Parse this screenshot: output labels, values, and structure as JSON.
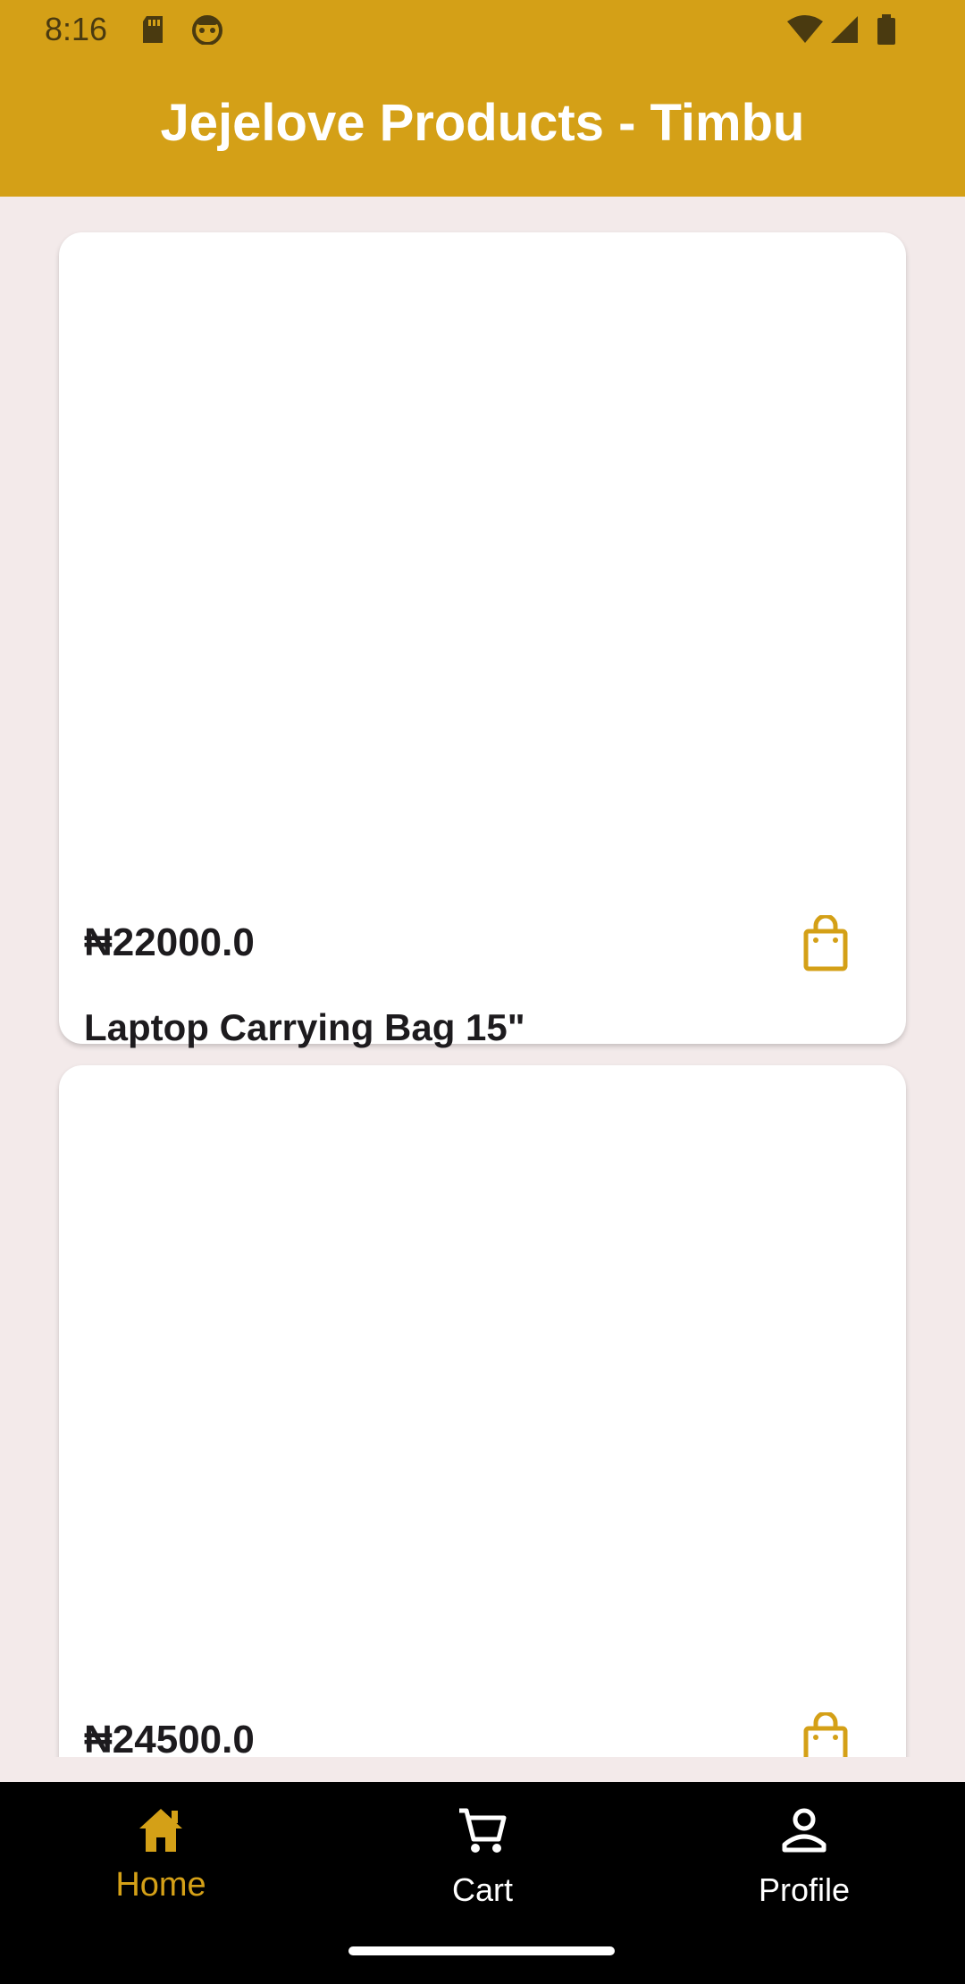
{
  "status_bar": {
    "time": "8:16",
    "icons": [
      "sd-card-icon",
      "android-face-icon",
      "wifi-icon",
      "signal-icon",
      "battery-icon"
    ]
  },
  "app_bar": {
    "title": "Jejelove Products - Timbu",
    "color": "#d4a017"
  },
  "products": [
    {
      "price": "₦22000.0",
      "name": "Laptop Carrying Bag 15\""
    },
    {
      "price": "₦24500.0",
      "name": ""
    }
  ],
  "bottom_nav": {
    "items": [
      {
        "label": "Home",
        "icon": "home-icon",
        "active": true
      },
      {
        "label": "Cart",
        "icon": "cart-icon",
        "active": false
      },
      {
        "label": "Profile",
        "icon": "profile-icon",
        "active": false
      }
    ],
    "active_color": "#d4a017"
  }
}
